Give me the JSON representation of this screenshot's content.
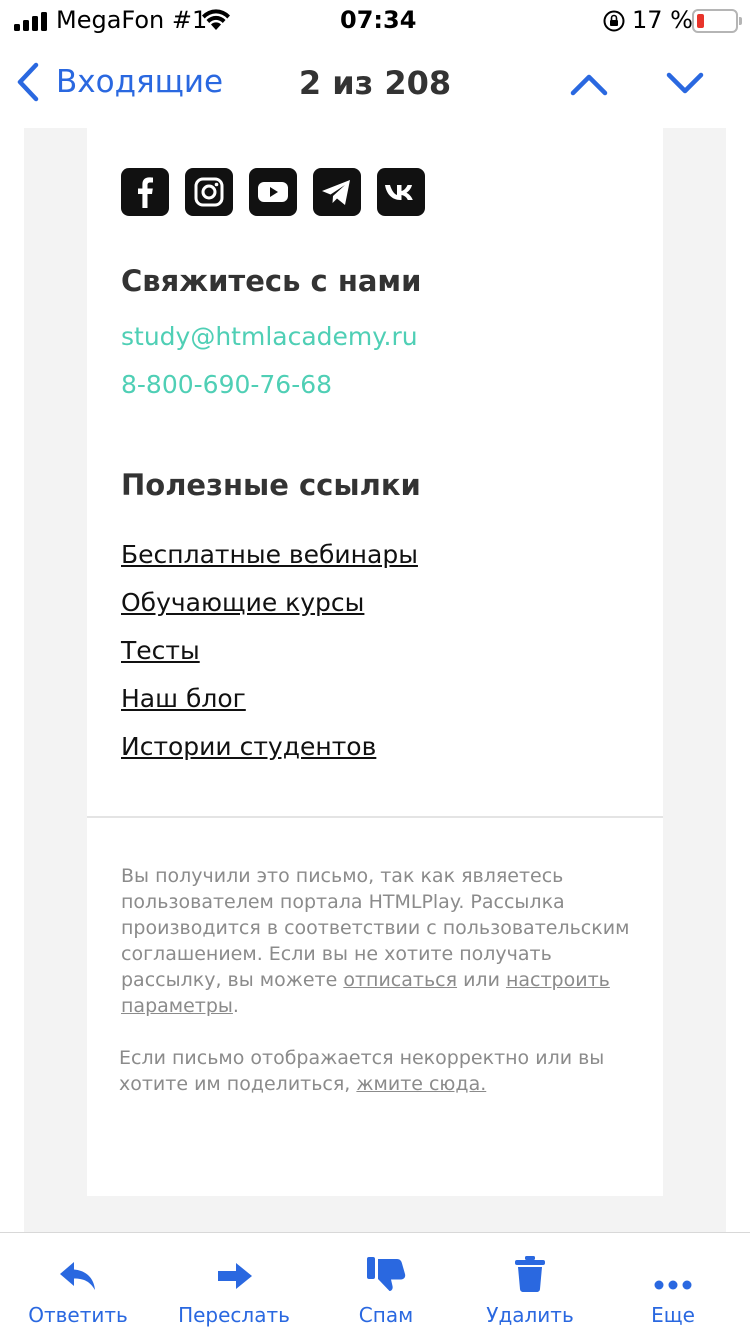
{
  "status_bar": {
    "carrier": "MegaFon #1",
    "time": "07:34",
    "battery": "17 %"
  },
  "nav": {
    "back_label": "Входящие",
    "counter": "2 из 208"
  },
  "colors": {
    "accent": "#2a68e0",
    "contact_link": "#4fcfb5",
    "battery_low": "#e8342b"
  },
  "email": {
    "socials": [
      "facebook-icon",
      "instagram-icon",
      "youtube-icon",
      "telegram-icon",
      "vk-icon"
    ],
    "contact_title": "Свяжитесь с нами",
    "contact_email": "study@htmlacademy.ru",
    "contact_phone": "8-800-690-76-68",
    "links_title": "Полезные ссылки",
    "links": [
      "Бесплатные вебинары",
      "Обучающие курсы",
      "Тесты",
      "Наш блог",
      "Истории студентов"
    ],
    "footer": {
      "p1_text": "Вы получили это письмо, так как являетесь пользователем портала HTMLPlay. Рассылка производится в соответствии с пользовательским соглашением. Если вы не хотите получать рассылку, вы можете ",
      "unsubscribe": "отписаться",
      "or": " или ",
      "settings": "настроить параметры",
      "p1_end": ".",
      "p2_text": "Если письмо отображается некорректно или вы хотите им поделиться, ",
      "p2_link": "жмите сюда."
    }
  },
  "toolbar": {
    "reply": "Ответить",
    "forward": "Переслать",
    "spam": "Спам",
    "delete": "Удалить",
    "more": "Еще"
  }
}
